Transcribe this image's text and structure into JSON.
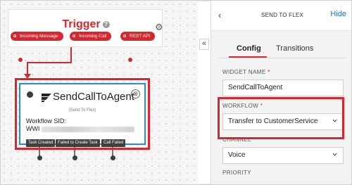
{
  "trigger": {
    "title": "Trigger",
    "help_glyph": "?",
    "icon": "gear-icon",
    "pills": [
      "Incoming Message",
      "Incoming Call",
      "REST API"
    ]
  },
  "widget": {
    "title": "SendCallToAgent",
    "subtitle": "(Send To Flex)",
    "sid_label": "Workflow SID:",
    "sid_prefix": "WWI",
    "close_glyph": "⊗",
    "transitions": [
      "Task Created",
      "Failed to Create Task",
      "Call Failed"
    ]
  },
  "collapse_glyph": "«",
  "panel": {
    "back_glyph": "‹",
    "title": "SEND TO FLEX",
    "hide": "Hide",
    "tabs": [
      {
        "label": "Config",
        "active": true
      },
      {
        "label": "Transitions",
        "active": false
      }
    ],
    "fields": {
      "widget_name": {
        "label": "WIDGET NAME",
        "required": "*",
        "value": "SendCallToAgent"
      },
      "workflow": {
        "label": "WORKFLOW",
        "required": "*",
        "value": "Transfer to CustomerService"
      },
      "channel": {
        "label": "CHANNEL",
        "value": "Voice"
      },
      "priority": {
        "label": "PRIORITY"
      }
    }
  },
  "colors": {
    "brand_red": "#d9262c",
    "selection_blue": "#2a8bd8",
    "link_blue": "#1a73c9"
  }
}
